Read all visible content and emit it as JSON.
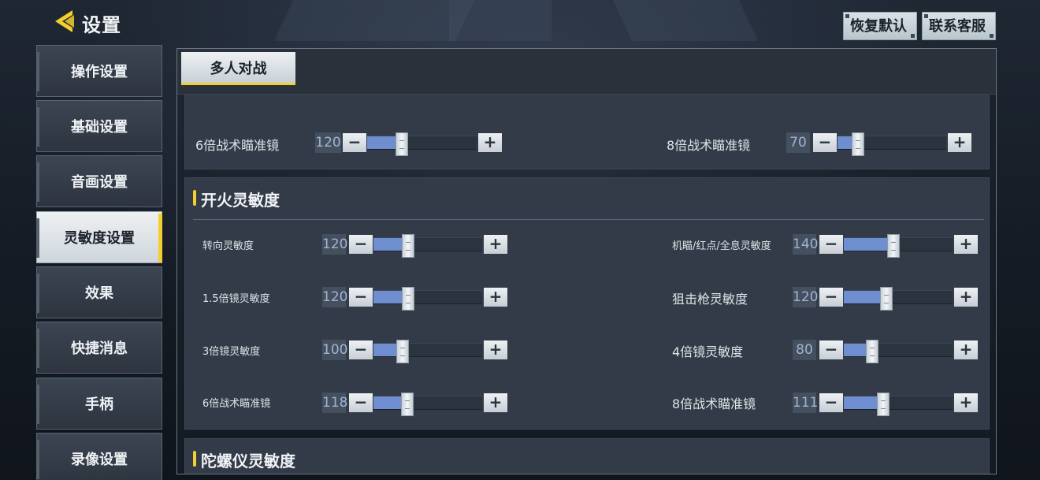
{
  "header": {
    "title": "设置",
    "back_icon": "back-arrow-icon",
    "reset_label": "恢复默认",
    "support_label": "联系客服"
  },
  "sidebar": {
    "items": [
      {
        "label": "操作设置"
      },
      {
        "label": "基础设置"
      },
      {
        "label": "音画设置"
      },
      {
        "label": "灵敏度设置",
        "active": true
      },
      {
        "label": "效果"
      },
      {
        "label": "快捷消息"
      },
      {
        "label": "手柄"
      },
      {
        "label": "录像设置"
      }
    ]
  },
  "tabs": {
    "active": "多人对战"
  },
  "camera_section": {
    "rows": [
      {
        "label": "6倍战术瞄准镜",
        "value": "120",
        "fill": 0.32
      },
      {
        "label": "8倍战术瞄准镜",
        "value": "70",
        "fill": 0.19
      }
    ]
  },
  "fire_section": {
    "title": "开火灵敏度",
    "left": [
      {
        "label": "转向灵敏度",
        "value": "120",
        "fill": 0.32
      },
      {
        "label": "1.5倍镜灵敏度",
        "value": "120",
        "fill": 0.32
      },
      {
        "label": "3倍镜灵敏度",
        "value": "100",
        "fill": 0.27
      },
      {
        "label": "6倍战术瞄准镜",
        "value": "118",
        "fill": 0.31
      }
    ],
    "right": [
      {
        "label": "机瞄/红点/全息灵敏度",
        "value": "140",
        "fill": 0.46
      },
      {
        "label": "狙击枪灵敏度",
        "value": "120",
        "fill": 0.39
      },
      {
        "label": "4倍镜灵敏度",
        "value": "80",
        "fill": 0.26
      },
      {
        "label": "8倍战术瞄准镜",
        "value": "111",
        "fill": 0.36
      }
    ]
  },
  "gyro_section": {
    "title": "陀螺仪灵敏度"
  },
  "colors": {
    "accent": "#f3cf2e",
    "slider_fill": "#6f8ed0"
  }
}
